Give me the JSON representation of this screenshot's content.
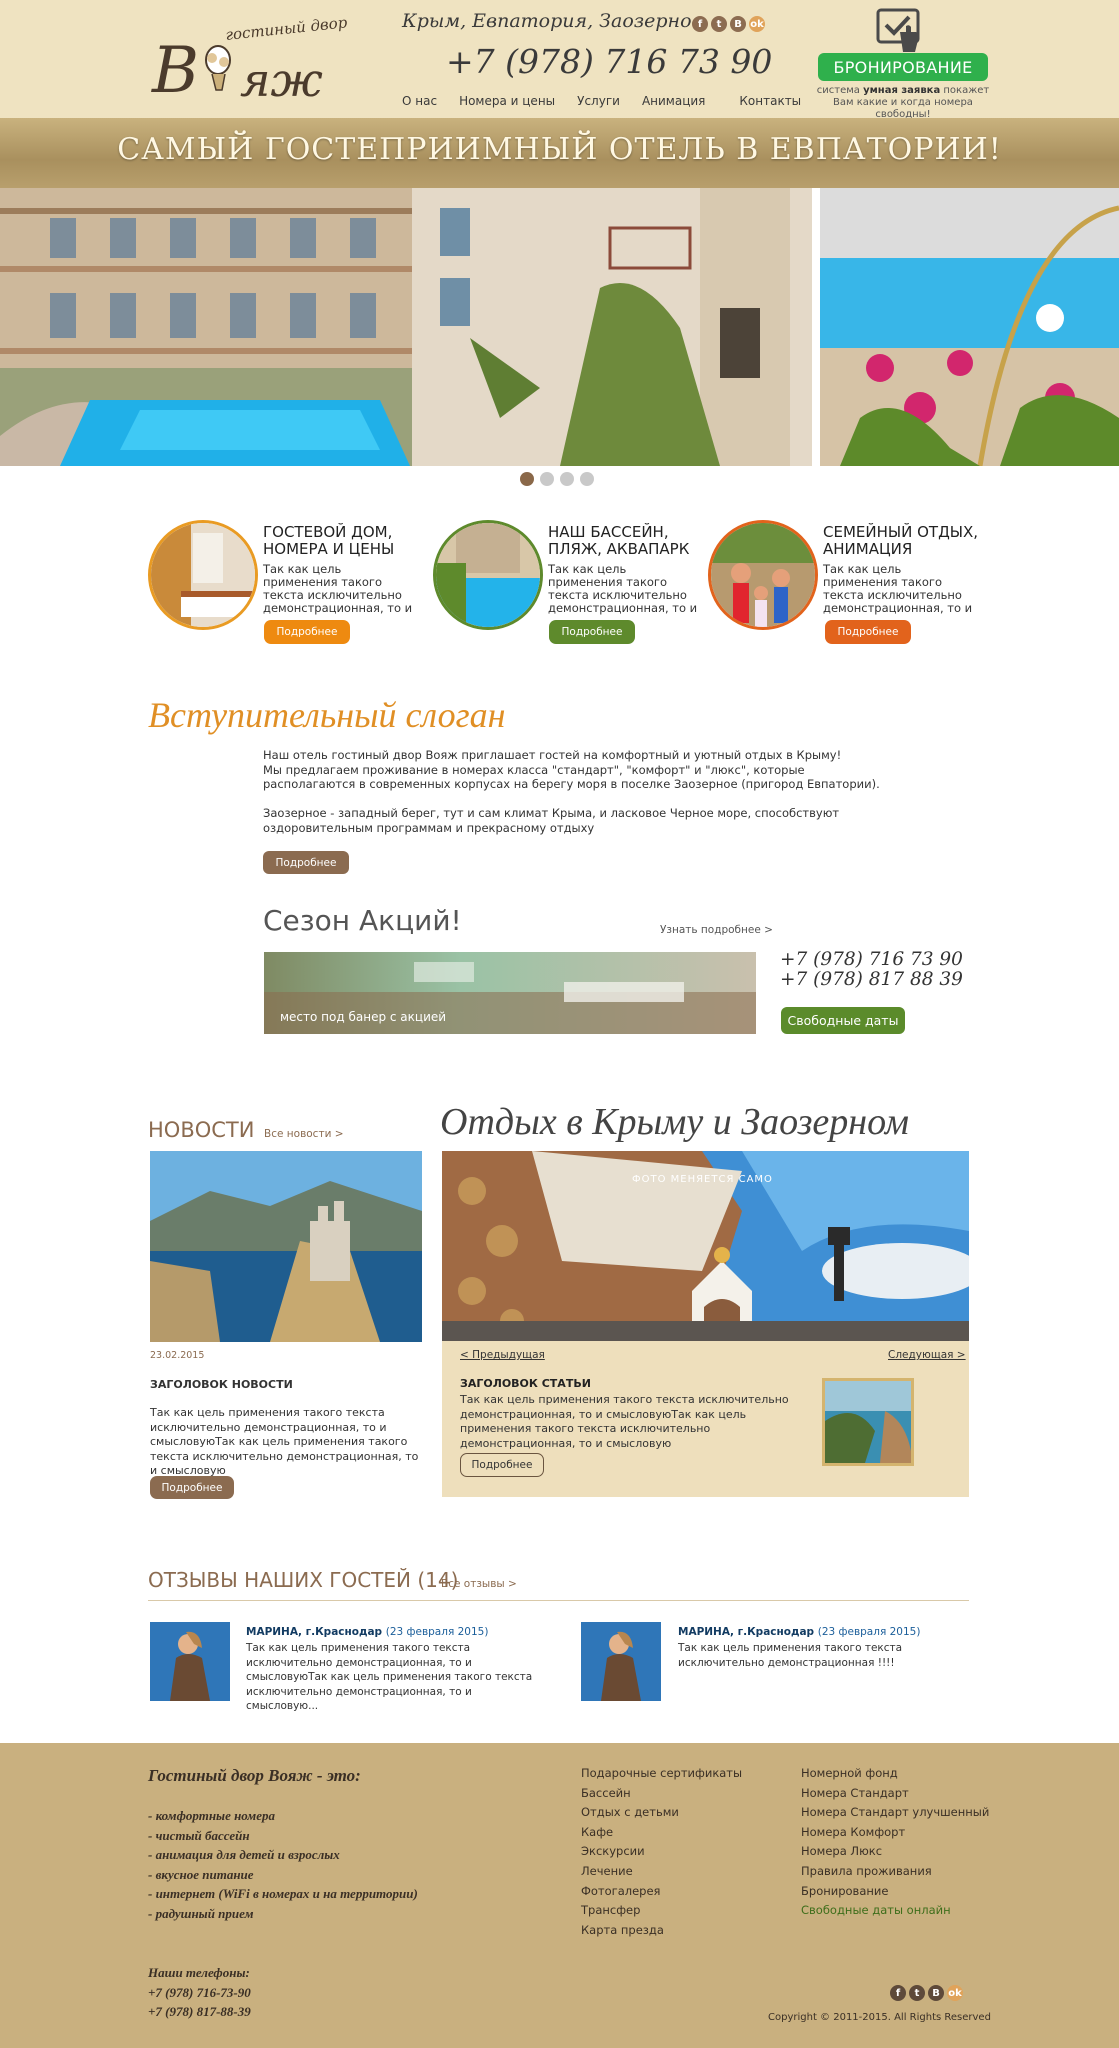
{
  "header": {
    "location": "Крым, Евпатория, Заозерное",
    "phone": "+7 (978) 716 73 90",
    "nav": [
      "О нас",
      "Номера и цены",
      "Услуги",
      "Анимация",
      "Контакты"
    ],
    "booking_label": "БРОНИРОВАНИЕ",
    "booking_note_pre": "система ",
    "booking_note_bold": "умная заявка",
    "booking_note_post": " покажет Вам какие и когда номера свободны!",
    "social": [
      "f",
      "t",
      "B",
      "ok"
    ]
  },
  "logo": {
    "script": "гостиный двор",
    "name": "Вояж"
  },
  "banner": {
    "text": "САМЫЙ ГОСТЕПРИИМНЫЙ ОТЕЛЬ В ЕВПАТОРИИ!"
  },
  "slider": {
    "count": 4,
    "active": 0
  },
  "features": [
    {
      "title1": "ГОСТЕВОЙ ДОМ,",
      "title2": "НОМЕРА И ЦЕНЫ",
      "text": "Так как цель применения такого текста исключительно демонстрационная, то и",
      "button": "Подробнее",
      "color": "#ee8a10",
      "border": "#e99b23"
    },
    {
      "title1": "НАШ БАССЕЙН,",
      "title2": "ПЛЯЖ, АКВАПАРК",
      "text": "Так как цель применения такого текста исключительно демонстрационная, то и",
      "button": "Подробнее",
      "color": "#5e8a2c",
      "border": "#5e8a2c"
    },
    {
      "title1": "СЕМЕЙНЫЙ ОТДЫХ,",
      "title2": "АНИМАЦИЯ",
      "text": "Так как цель применения такого текста исключительно демонстрационная, то и",
      "button": "Подробнее",
      "color": "#e2631c",
      "border": "#e2631c"
    }
  ],
  "intro": {
    "slogan": "Вступительный слоган",
    "p1": "Наш отель гостиный двор Вояж  приглашает гостей на комфортный и уютный отдых в Крыму!",
    "p2": "Мы предлагаем проживание в номерах класса \"стандарт\", \"комфорт\" и \"люкс\", которые располагаются в современных корпусах на берегу моря в поселке Заозерное (пригород Евпатории).",
    "p3": "Заозерное - западный берег, тут и сам климат Крыма, и ласковое Черное море, способствуют оздоровительным программам и прекрасному отдыху",
    "button": "Подробнее"
  },
  "promo": {
    "title": "Сезон Акций!",
    "more": "Узнать подробнее >",
    "banner_label": "место под банер с акцией",
    "phone1": "+7 (978) 716 73 90",
    "phone2": "+7 (978) 817 88 39",
    "free_dates": "Свободные даты"
  },
  "news": {
    "title": "НОВОСТИ",
    "all": "Все новости >",
    "date": "23.02.2015",
    "headline": "ЗАГОЛОВОК НОВОСТИ",
    "text": "Так как цель применения такого текста исключительно демонстрационная, то и смысловуюТак как цель применения такого текста исключительно демонстрационная, то и смысловую",
    "button": "Подробнее"
  },
  "rest": {
    "title": "Отдых в Крыму и Заозерном",
    "caption": "ФОТО МЕНЯЕТСЯ САМО",
    "prev": "< Предыдущая",
    "next": "Следующая >",
    "headline": "ЗАГОЛОВОК СТАТЬИ",
    "text": "Так как цель применения такого текста исключительно демонстрационная, то и смысловуюТак как цель применения такого текста исключительно демонстрационная, то и смысловую",
    "button": "Подробнее"
  },
  "reviews": {
    "title": "ОТЗЫВЫ НАШИХ ГОСТЕЙ (14)",
    "all": "Все отзывы >",
    "items": [
      {
        "name": "МАРИНА, г.Краснодар",
        "date": "(23 февраля 2015)",
        "text": "Так как цель применения такого текста исключительно демонстрационная, то и смысловуюТак как цель применения такого текста исключительно демонстрационная, то и смысловую..."
      },
      {
        "name": "МАРИНА, г.Краснодар",
        "date": "(23 февраля 2015)",
        "text": "Так как цель применения такого текста исключительно демонстрационная !!!!"
      }
    ]
  },
  "footer": {
    "title": "Гостиный двор Вояж - это:",
    "features": [
      "- комфортные номера",
      "- чистый бассейн",
      "- анимация для детей и взрослых",
      "- вкусное питание",
      "- интернет (WiFi в номерах и на территории)",
      "- радушный прием"
    ],
    "phones_title": "Наши телефоны:",
    "phone1": "+7 (978) 716-73-90",
    "phone2": "+7 (978) 817-88-39",
    "col1": [
      "Подарочные сертификаты",
      "Бассейн",
      "Отдых с детьми",
      "Кафе",
      "Экскурсии",
      "Лечение",
      "Фотогалерея",
      "Трансфер",
      "Карта презда"
    ],
    "col2": [
      "Номерной фонд",
      "Номера Стандарт",
      "Номера Стандарт улучшенный",
      "Номера Комфорт",
      "Номера Люкс",
      "Правила проживания",
      "Бронирование",
      "Свободные даты онлайн"
    ],
    "copyright": "Copyright © 2011-2015. All Rights Reserved"
  }
}
